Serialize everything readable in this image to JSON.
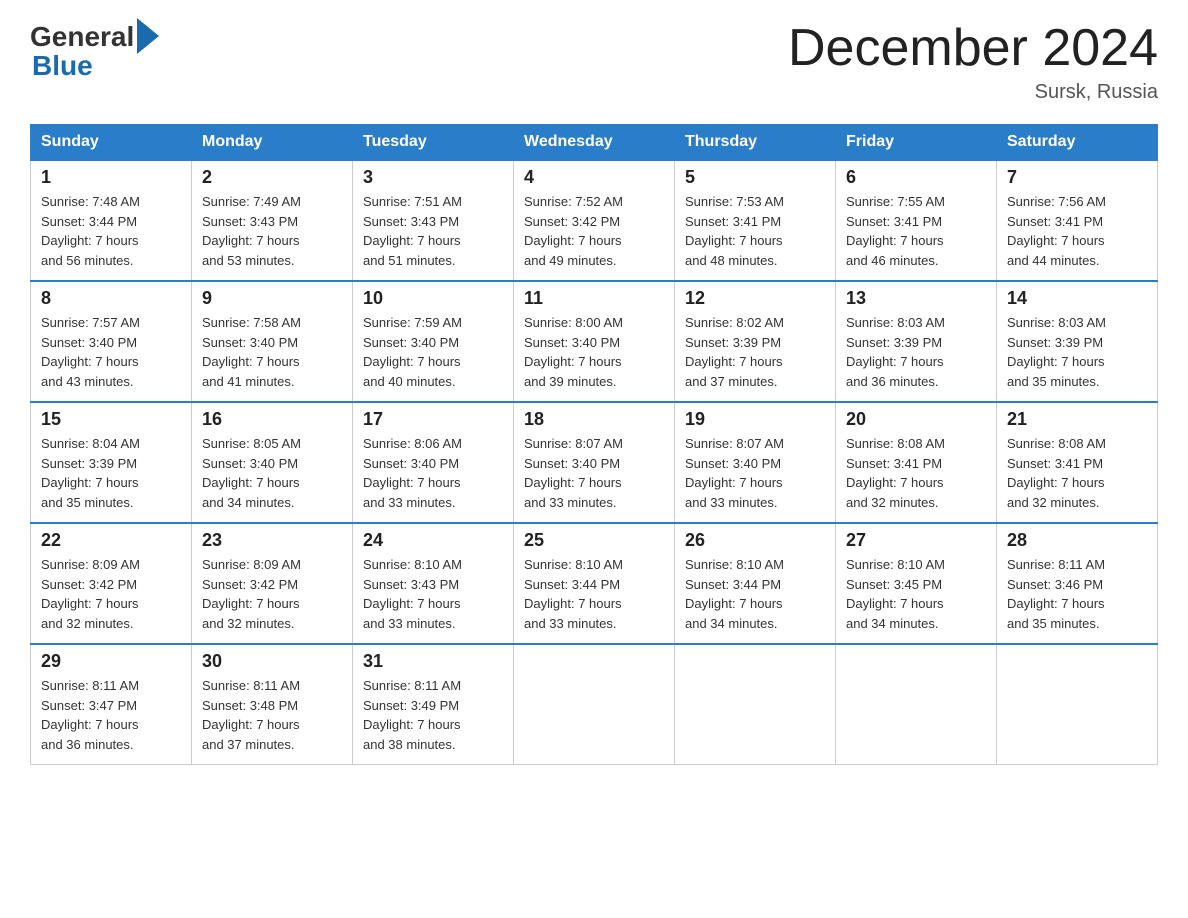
{
  "header": {
    "logo_general": "General",
    "logo_blue": "Blue",
    "title": "December 2024",
    "subtitle": "Sursk, Russia"
  },
  "calendar": {
    "days_of_week": [
      "Sunday",
      "Monday",
      "Tuesday",
      "Wednesday",
      "Thursday",
      "Friday",
      "Saturday"
    ],
    "weeks": [
      [
        {
          "day": "1",
          "info": "Sunrise: 7:48 AM\nSunset: 3:44 PM\nDaylight: 7 hours\nand 56 minutes."
        },
        {
          "day": "2",
          "info": "Sunrise: 7:49 AM\nSunset: 3:43 PM\nDaylight: 7 hours\nand 53 minutes."
        },
        {
          "day": "3",
          "info": "Sunrise: 7:51 AM\nSunset: 3:43 PM\nDaylight: 7 hours\nand 51 minutes."
        },
        {
          "day": "4",
          "info": "Sunrise: 7:52 AM\nSunset: 3:42 PM\nDaylight: 7 hours\nand 49 minutes."
        },
        {
          "day": "5",
          "info": "Sunrise: 7:53 AM\nSunset: 3:41 PM\nDaylight: 7 hours\nand 48 minutes."
        },
        {
          "day": "6",
          "info": "Sunrise: 7:55 AM\nSunset: 3:41 PM\nDaylight: 7 hours\nand 46 minutes."
        },
        {
          "day": "7",
          "info": "Sunrise: 7:56 AM\nSunset: 3:41 PM\nDaylight: 7 hours\nand 44 minutes."
        }
      ],
      [
        {
          "day": "8",
          "info": "Sunrise: 7:57 AM\nSunset: 3:40 PM\nDaylight: 7 hours\nand 43 minutes."
        },
        {
          "day": "9",
          "info": "Sunrise: 7:58 AM\nSunset: 3:40 PM\nDaylight: 7 hours\nand 41 minutes."
        },
        {
          "day": "10",
          "info": "Sunrise: 7:59 AM\nSunset: 3:40 PM\nDaylight: 7 hours\nand 40 minutes."
        },
        {
          "day": "11",
          "info": "Sunrise: 8:00 AM\nSunset: 3:40 PM\nDaylight: 7 hours\nand 39 minutes."
        },
        {
          "day": "12",
          "info": "Sunrise: 8:02 AM\nSunset: 3:39 PM\nDaylight: 7 hours\nand 37 minutes."
        },
        {
          "day": "13",
          "info": "Sunrise: 8:03 AM\nSunset: 3:39 PM\nDaylight: 7 hours\nand 36 minutes."
        },
        {
          "day": "14",
          "info": "Sunrise: 8:03 AM\nSunset: 3:39 PM\nDaylight: 7 hours\nand 35 minutes."
        }
      ],
      [
        {
          "day": "15",
          "info": "Sunrise: 8:04 AM\nSunset: 3:39 PM\nDaylight: 7 hours\nand 35 minutes."
        },
        {
          "day": "16",
          "info": "Sunrise: 8:05 AM\nSunset: 3:40 PM\nDaylight: 7 hours\nand 34 minutes."
        },
        {
          "day": "17",
          "info": "Sunrise: 8:06 AM\nSunset: 3:40 PM\nDaylight: 7 hours\nand 33 minutes."
        },
        {
          "day": "18",
          "info": "Sunrise: 8:07 AM\nSunset: 3:40 PM\nDaylight: 7 hours\nand 33 minutes."
        },
        {
          "day": "19",
          "info": "Sunrise: 8:07 AM\nSunset: 3:40 PM\nDaylight: 7 hours\nand 33 minutes."
        },
        {
          "day": "20",
          "info": "Sunrise: 8:08 AM\nSunset: 3:41 PM\nDaylight: 7 hours\nand 32 minutes."
        },
        {
          "day": "21",
          "info": "Sunrise: 8:08 AM\nSunset: 3:41 PM\nDaylight: 7 hours\nand 32 minutes."
        }
      ],
      [
        {
          "day": "22",
          "info": "Sunrise: 8:09 AM\nSunset: 3:42 PM\nDaylight: 7 hours\nand 32 minutes."
        },
        {
          "day": "23",
          "info": "Sunrise: 8:09 AM\nSunset: 3:42 PM\nDaylight: 7 hours\nand 32 minutes."
        },
        {
          "day": "24",
          "info": "Sunrise: 8:10 AM\nSunset: 3:43 PM\nDaylight: 7 hours\nand 33 minutes."
        },
        {
          "day": "25",
          "info": "Sunrise: 8:10 AM\nSunset: 3:44 PM\nDaylight: 7 hours\nand 33 minutes."
        },
        {
          "day": "26",
          "info": "Sunrise: 8:10 AM\nSunset: 3:44 PM\nDaylight: 7 hours\nand 34 minutes."
        },
        {
          "day": "27",
          "info": "Sunrise: 8:10 AM\nSunset: 3:45 PM\nDaylight: 7 hours\nand 34 minutes."
        },
        {
          "day": "28",
          "info": "Sunrise: 8:11 AM\nSunset: 3:46 PM\nDaylight: 7 hours\nand 35 minutes."
        }
      ],
      [
        {
          "day": "29",
          "info": "Sunrise: 8:11 AM\nSunset: 3:47 PM\nDaylight: 7 hours\nand 36 minutes."
        },
        {
          "day": "30",
          "info": "Sunrise: 8:11 AM\nSunset: 3:48 PM\nDaylight: 7 hours\nand 37 minutes."
        },
        {
          "day": "31",
          "info": "Sunrise: 8:11 AM\nSunset: 3:49 PM\nDaylight: 7 hours\nand 38 minutes."
        },
        null,
        null,
        null,
        null
      ]
    ]
  }
}
